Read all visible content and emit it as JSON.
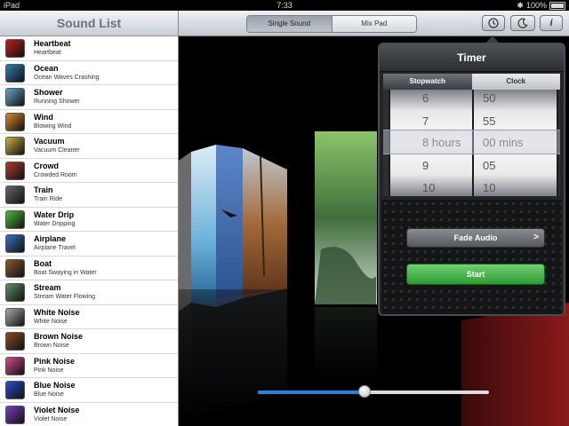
{
  "status_bar": {
    "device": "iPad",
    "time": "7:33",
    "battery": "100%"
  },
  "sidebar": {
    "title": "Sound List",
    "items": [
      {
        "title": "Heartbeat",
        "subtitle": "Heartbeat",
        "color": "#c21d1d"
      },
      {
        "title": "Ocean",
        "subtitle": "Ocean Waves Crashing",
        "color": "#2f7fb5"
      },
      {
        "title": "Shower",
        "subtitle": "Running Shower",
        "color": "#6aa3c9"
      },
      {
        "title": "Wind",
        "subtitle": "Blowing Wind",
        "color": "#d98a2b"
      },
      {
        "title": "Vacuum",
        "subtitle": "Vacuum Cleaner",
        "color": "#c9b044"
      },
      {
        "title": "Crowd",
        "subtitle": "Crowded Room",
        "color": "#b03a2a"
      },
      {
        "title": "Train",
        "subtitle": "Train Ride",
        "color": "#666666"
      },
      {
        "title": "Water Drip",
        "subtitle": "Water Dripping",
        "color": "#4dbb3a"
      },
      {
        "title": "Airplane",
        "subtitle": "Airplane Travel",
        "color": "#3a6fc0"
      },
      {
        "title": "Boat",
        "subtitle": "Boat Swaying in Water",
        "color": "#8a5a2e"
      },
      {
        "title": "Stream",
        "subtitle": "Stream Water Flowing",
        "color": "#5a8f6a"
      },
      {
        "title": "White Noise",
        "subtitle": "White Noise",
        "color": "#aaaaaa"
      },
      {
        "title": "Brown Noise",
        "subtitle": "Brown Noise",
        "color": "#8a4a25"
      },
      {
        "title": "Pink Noise",
        "subtitle": "Pink Noise",
        "color": "#d24a8a"
      },
      {
        "title": "Blue Noise",
        "subtitle": "Blue Noise",
        "color": "#2a4ad2"
      },
      {
        "title": "Violet Noise",
        "subtitle": "Violet Noise",
        "color": "#7a3ac2"
      }
    ]
  },
  "topbar": {
    "tab_single": "Single Sound",
    "tab_mix": "Mix Pad",
    "icons": [
      "clock-icon",
      "moon-icon",
      "info-icon"
    ]
  },
  "timer": {
    "title": "Timer",
    "tab_stopwatch": "Stopwatch",
    "tab_clock": "Clock",
    "hours_wheel": [
      "6",
      "7",
      "8 hours",
      "9",
      "10"
    ],
    "mins_wheel": [
      "50",
      "55",
      "00 mins",
      "05",
      "10"
    ],
    "fade_label": "Fade Audio",
    "fade_arrow": ">",
    "start_label": "Start"
  },
  "volume": {
    "level": 0.46
  },
  "colors": {
    "accent": "#2f7de1",
    "start_green": "#3aa83f"
  }
}
